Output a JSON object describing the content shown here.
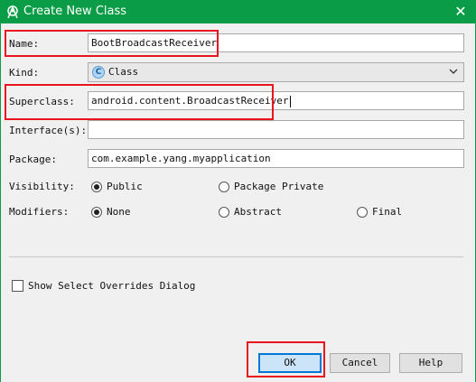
{
  "window": {
    "title": "Create New Class",
    "close_glyph": "✕"
  },
  "form": {
    "name_label": "Name:",
    "name_value": "BootBroadcastReceiver",
    "kind_label": "Kind:",
    "kind_value": "Class",
    "kind_icon_letter": "C",
    "superclass_label": "Superclass:",
    "superclass_value": "android.content.BroadcastReceiver",
    "interfaces_label": "Interface(s):",
    "interfaces_value": "",
    "package_label": "Package:",
    "package_value": "com.example.yang.myapplication",
    "visibility_label": "Visibility:",
    "visibility_options": [
      "Public",
      "Package Private"
    ],
    "visibility_selected": "Public",
    "modifiers_label": "Modifiers:",
    "modifiers_options": [
      "None",
      "Abstract",
      "Final"
    ],
    "modifiers_selected": "None",
    "show_overrides_label": "Show Select Overrides Dialog",
    "show_overrides_checked": false
  },
  "buttons": {
    "ok": "OK",
    "cancel": "Cancel",
    "help": "Help"
  },
  "colors": {
    "titlebar": "#0a9c46",
    "highlight": "#e8141e",
    "default_button": "#0078d7"
  }
}
